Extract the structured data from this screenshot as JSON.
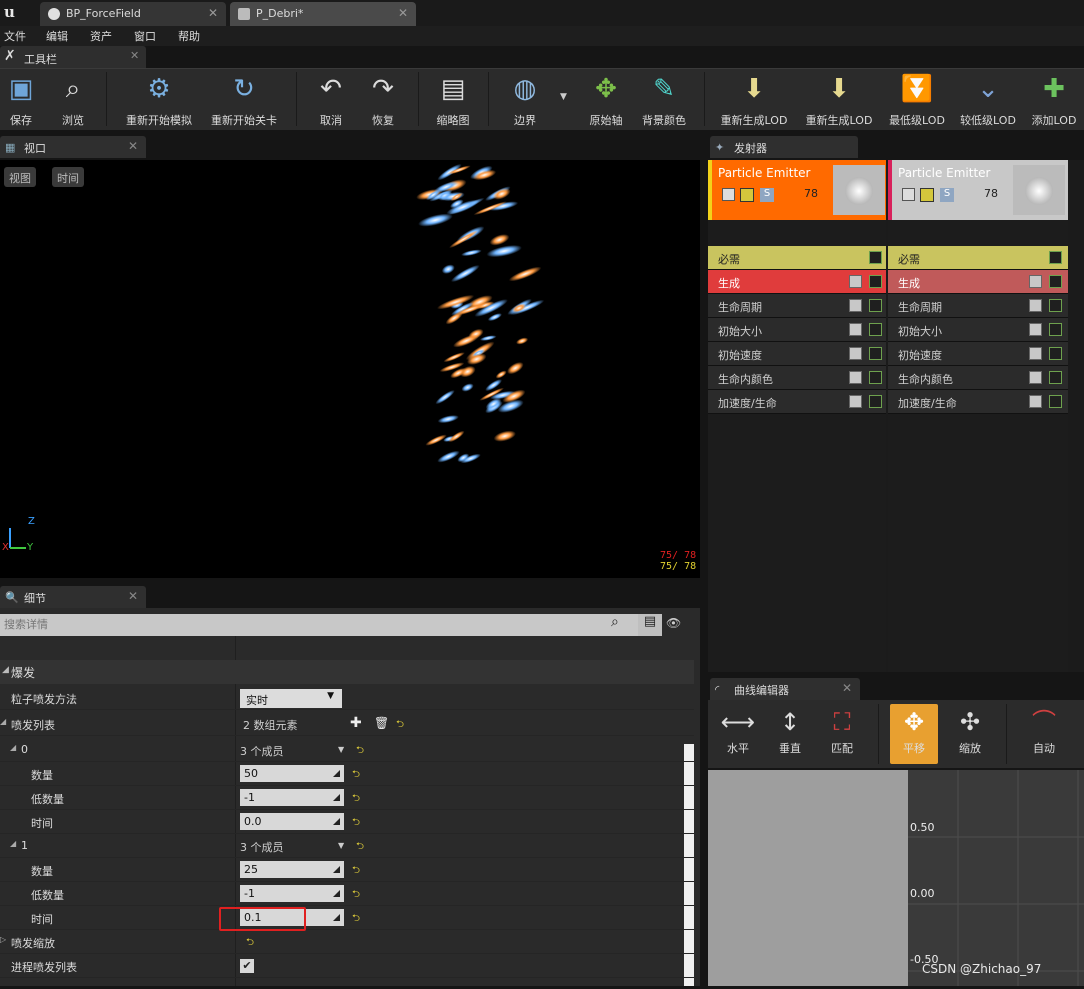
{
  "tabs": [
    {
      "label": "BP_ForceField"
    },
    {
      "label": "P_Debri*"
    }
  ],
  "menu": [
    "文件",
    "编辑",
    "资产",
    "窗口",
    "帮助"
  ],
  "toolbar": {
    "tab_label": "工具栏",
    "buttons": [
      {
        "label": "保存",
        "icon": "save-icon"
      },
      {
        "label": "浏览",
        "icon": "browse-icon"
      },
      {
        "label": "重新开始模拟",
        "icon": "restart-sim-icon"
      },
      {
        "label": "重新开始关卡",
        "icon": "restart-level-icon"
      },
      {
        "label": "取消",
        "icon": "undo-icon"
      },
      {
        "label": "恢复",
        "icon": "redo-icon"
      },
      {
        "label": "缩略图",
        "icon": "thumbnail-icon"
      },
      {
        "label": "边界",
        "icon": "bounds-icon"
      },
      {
        "label": "原始轴",
        "icon": "axis-icon"
      },
      {
        "label": "背景颜色",
        "icon": "bg-color-icon"
      },
      {
        "label": "重新生成LOD",
        "icon": "regen-lod-icon"
      },
      {
        "label": "重新生成LOD",
        "icon": "regen-lod2-icon"
      },
      {
        "label": "最低级LOD",
        "icon": "lowest-lod-icon"
      },
      {
        "label": "较低级LOD",
        "icon": "lower-lod-icon"
      },
      {
        "label": "添加LOD",
        "icon": "add-lod-icon"
      }
    ]
  },
  "viewport": {
    "tab_label": "视口",
    "btn_view": "视图",
    "btn_time": "时间",
    "stat1": "75/  78",
    "stat2": "75/  78",
    "axis_z": "Z",
    "axis_x": "X",
    "axis_y": "Y"
  },
  "details": {
    "tab_label": "细节",
    "search_placeholder": "搜索详情",
    "section": "爆发",
    "rows": [
      {
        "label": "粒子喷发方法",
        "value": "实时"
      },
      {
        "label": "喷发列表",
        "value": "2 数组元素"
      },
      {
        "label": "0",
        "value": "3 个成员"
      },
      {
        "label": "数量",
        "value": "50"
      },
      {
        "label": "低数量",
        "value": "-1"
      },
      {
        "label": "时间",
        "value": "0.0"
      },
      {
        "label": "1",
        "value": "3 个成员"
      },
      {
        "label": "数量",
        "value": "25"
      },
      {
        "label": "低数量",
        "value": "-1"
      },
      {
        "label": "时间",
        "value": "0.1"
      },
      {
        "label": "喷发缩放",
        "value": ""
      },
      {
        "label": "进程喷发列表",
        "value": ""
      }
    ]
  },
  "emitters": {
    "tab_label": "发射器",
    "columns": [
      {
        "name": "Particle Emitter",
        "count": "78",
        "modules": [
          "必需",
          "生成",
          "生命周期",
          "初始大小",
          "初始速度",
          "生命内颜色",
          "加速度/生命"
        ]
      },
      {
        "name": "Particle Emitter",
        "count": "78",
        "modules": [
          "必需",
          "生成",
          "生命周期",
          "初始大小",
          "初始速度",
          "生命内颜色",
          "加速度/生命"
        ]
      }
    ]
  },
  "curve_editor": {
    "tab_label": "曲线编辑器",
    "buttons": [
      "水平",
      "垂直",
      "匹配",
      "平移",
      "缩放",
      "自动"
    ],
    "ticks": [
      "0.50",
      "0.00",
      "-0.50"
    ]
  },
  "watermark": "CSDN @Zhichao_97",
  "colors": {
    "emitter_selected": "#ff6a00",
    "required_row": "#c9c45f",
    "spawn_row": "#e03c3c",
    "highlight": "#e02020"
  }
}
